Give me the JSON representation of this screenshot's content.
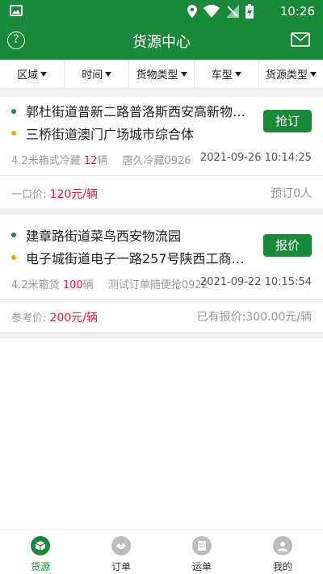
{
  "status_bar": {
    "time": "10:26"
  },
  "app_bar": {
    "title": "货源中心",
    "help_glyph": "?"
  },
  "filters": [
    {
      "label": "区域"
    },
    {
      "label": "时间"
    },
    {
      "label": "货物类型"
    },
    {
      "label": "车型"
    },
    {
      "label": "货源类型"
    }
  ],
  "cards": [
    {
      "origin": "郭杜街道普新二路普洛斯西安高新物…",
      "destination": "三桥街道澳门广场城市综合体",
      "action": "抢订",
      "vehicle": "4.2米箱式冷藏",
      "quantity": "12",
      "unit": "辆",
      "cargo": "唐久冷藏0926",
      "datetime": "2021-09-26 10:14:25",
      "price_label": "一口价:",
      "price": "120元/辆",
      "right_info": "预订0人"
    },
    {
      "origin": "建章路街道菜鸟西安物流园",
      "destination": "电子城街道电子一路257号陕西工商职…",
      "action": "报价",
      "vehicle": "4.2米箱货",
      "quantity": "100",
      "unit": "辆",
      "cargo": "测试订单随便抢0922",
      "datetime": "2021-09-22 10:15:54",
      "price_label": "参考价:",
      "price": "200元/辆",
      "right_info": "已有报价:300.00元/辆"
    }
  ],
  "tabs": [
    {
      "label": "货源",
      "icon": "cube-icon",
      "active": true
    },
    {
      "label": "订单",
      "icon": "handshake-icon",
      "active": false
    },
    {
      "label": "运单",
      "icon": "document-icon",
      "active": false
    },
    {
      "label": "我的",
      "icon": "user-icon",
      "active": false
    }
  ],
  "colors": {
    "primary": "#1a8a3a",
    "accent_red": "#e0243a",
    "dot_orange": "#f2a800"
  }
}
